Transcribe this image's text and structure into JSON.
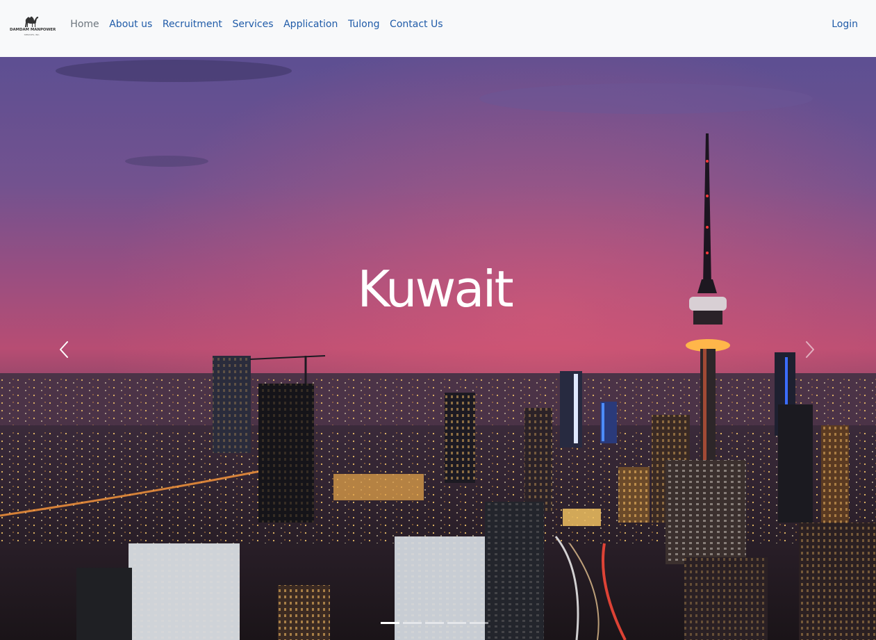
{
  "brand": {
    "name": "DAMDAM MANPOWER",
    "tagline": "SERVICES, INC.",
    "logo_icon": "camel-icon"
  },
  "nav": {
    "items": [
      {
        "label": "Home",
        "active": true
      },
      {
        "label": "About us",
        "active": false
      },
      {
        "label": "Recruitment",
        "active": false
      },
      {
        "label": "Services",
        "active": false
      },
      {
        "label": "Application",
        "active": false
      },
      {
        "label": "Tulong",
        "active": false
      },
      {
        "label": "Contact Us",
        "active": false
      }
    ],
    "login_label": "Login"
  },
  "carousel": {
    "caption": "Kuwait",
    "prev_icon": "chevron-left-icon",
    "next_icon": "chevron-right-icon",
    "slide_count": 5,
    "active_slide": 1
  },
  "colors": {
    "link": "#1f5ba8",
    "active_link": "#6c757d",
    "navbar_bg": "#f8f9fa",
    "sky_top": "#6a5a9c",
    "sky_mid": "#b64d75",
    "city_lights": "#f2a84a"
  }
}
